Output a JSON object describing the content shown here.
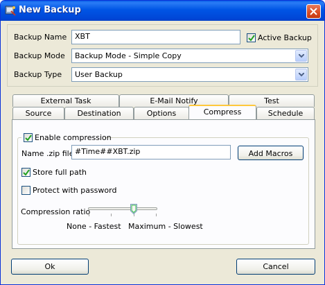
{
  "window": {
    "title": "New Backup",
    "icon": "backup-app-icon"
  },
  "form": {
    "backup_name_label": "Backup Name",
    "backup_name_value": "XBT",
    "active_backup_label": "Active Backup",
    "active_backup_checked": true,
    "backup_mode_label": "Backup Mode",
    "backup_mode_value": "Backup Mode - Simple Copy",
    "backup_type_label": "Backup Type",
    "backup_type_value": "User Backup"
  },
  "tabs": {
    "row_back": [
      "External Task",
      "E-Mail Notify",
      "Test"
    ],
    "row_front": [
      "Source",
      "Destination",
      "Options",
      "Compress",
      "Schedule"
    ],
    "active": "Compress"
  },
  "compress": {
    "enable_label": "Enable compression",
    "enable_checked": true,
    "zip_name_label": "Name .zip file",
    "zip_name_value": "#Time##XBT.zip",
    "add_macros_label": "Add Macros",
    "store_full_path_label": "Store full path",
    "store_full_path_checked": true,
    "protect_password_label": "Protect with password",
    "protect_password_checked": false,
    "ratio_label": "Compression ratio",
    "ratio_min_label": "None - Fastest",
    "ratio_max_label": "Maximum - Slowest",
    "ratio_level": 0.67
  },
  "buttons": {
    "ok": "Ok",
    "cancel": "Cancel"
  }
}
